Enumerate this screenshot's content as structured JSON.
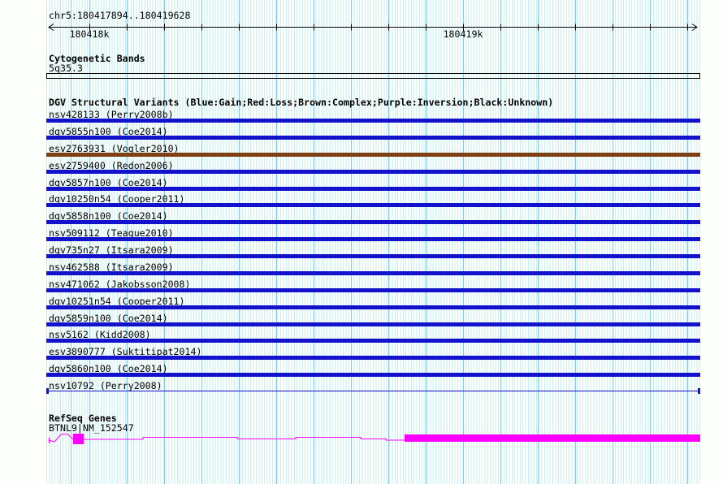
{
  "header": {
    "region_title": "chr5:180417894..180419628",
    "ruler_labels": [
      "180418k",
      "180419k"
    ]
  },
  "cytogenetic": {
    "title": "Cytogenetic Bands",
    "band_label": "5q35.3"
  },
  "dgv": {
    "title": "DGV Structural Variants (Blue:Gain;Red:Loss;Brown:Complex;Purple:Inversion;Black:Unknown)",
    "tracks": [
      {
        "label": "nsv428133 (Perry2008b)",
        "color": "blue",
        "glyph": "bar"
      },
      {
        "label": "dgv5855n100 (Coe2014)",
        "color": "blue",
        "glyph": "bar"
      },
      {
        "label": "esv2763931 (Vogler2010)",
        "color": "brown",
        "glyph": "bar"
      },
      {
        "label": "esv2759400 (Redon2006)",
        "color": "blue",
        "glyph": "bar"
      },
      {
        "label": "dgv5857n100 (Coe2014)",
        "color": "blue",
        "glyph": "bar"
      },
      {
        "label": "dgv10250n54 (Cooper2011)",
        "color": "blue",
        "glyph": "bar"
      },
      {
        "label": "dgv5858n100 (Coe2014)",
        "color": "blue",
        "glyph": "bar"
      },
      {
        "label": "nsv509112 (Teague2010)",
        "color": "blue",
        "glyph": "bar"
      },
      {
        "label": "dgv735n27 (Itsara2009)",
        "color": "blue",
        "glyph": "bar"
      },
      {
        "label": "nsv462588 (Itsara2009)",
        "color": "blue",
        "glyph": "bar"
      },
      {
        "label": "nsv471062 (Jakobsson2008)",
        "color": "blue",
        "glyph": "bar"
      },
      {
        "label": "dgv10251n54 (Cooper2011)",
        "color": "blue",
        "glyph": "bar"
      },
      {
        "label": "dgv5859n100 (Coe2014)",
        "color": "blue",
        "glyph": "bar"
      },
      {
        "label": "nsv5162 (Kidd2008)",
        "color": "blue",
        "glyph": "bar"
      },
      {
        "label": "esv3890777 (Suktitipat2014)",
        "color": "blue",
        "glyph": "bar"
      },
      {
        "label": "dgv5860n100 (Coe2014)",
        "color": "blue",
        "glyph": "bar"
      },
      {
        "label": "nsv10792 (Perry2008)",
        "color": "blue",
        "glyph": "span-line"
      }
    ]
  },
  "refseq": {
    "title": "RefSeq Genes",
    "gene_label": "BTNL9|NM_152547"
  },
  "palette": {
    "gain_blue": "#1212cc",
    "complex_brown": "#7e4012",
    "gene_magenta": "#ff00ff",
    "grid_minor": "#c9edf0",
    "grid_major": "#8fc6e2"
  }
}
